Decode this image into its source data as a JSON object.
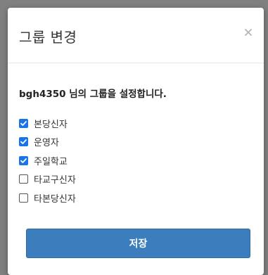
{
  "dialog": {
    "title": "그룹 변경",
    "prompt": "bgh4350 님의 그룹을 설정합니다.",
    "save_label": "저장"
  },
  "groups": [
    {
      "label": "본당신자",
      "checked": true
    },
    {
      "label": "운영자",
      "checked": true
    },
    {
      "label": "주일학교",
      "checked": true
    },
    {
      "label": "타교구신자",
      "checked": false
    },
    {
      "label": "타본당신자",
      "checked": false
    }
  ],
  "colors": {
    "checkbox_checked": "#1a73e8",
    "save_button": "#3c7dbd"
  }
}
